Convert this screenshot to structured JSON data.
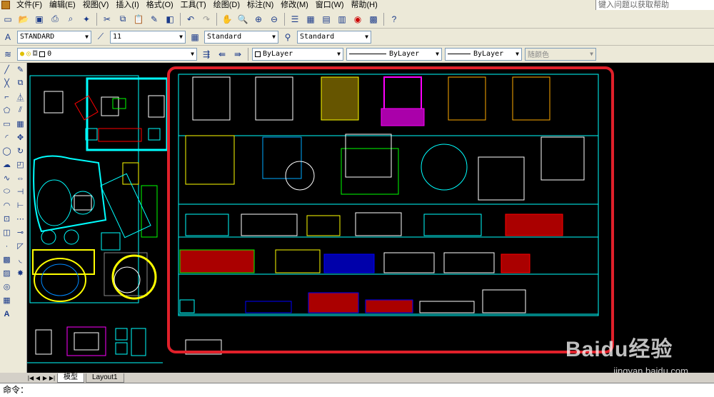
{
  "menu": [
    "文件(F)",
    "编辑(E)",
    "视图(V)",
    "插入(I)",
    "格式(O)",
    "工具(T)",
    "绘图(D)",
    "标注(N)",
    "修改(M)",
    "窗口(W)",
    "帮助(H)"
  ],
  "help_placeholder": "键入问题以获取帮助",
  "styles": {
    "text_style": "STANDARD",
    "dim_scale": "11",
    "dim_style": "Standard",
    "table_style": "Standard"
  },
  "layers": {
    "current": "0",
    "color": "ByLayer",
    "linetype": "ByLayer",
    "lineweight": "ByLayer",
    "plot_style": "随颜色"
  },
  "tabs": [
    "模型",
    "Layout1"
  ],
  "command_prompt": "命令：",
  "watermark": {
    "brand": "Baidu经验",
    "url": "jingyan.baidu.com"
  },
  "colors": {
    "highlight": "#e0202a",
    "cyan": "#00ffff",
    "yellow": "#ffff00",
    "magenta": "#ff00ff",
    "red": "#ff0000"
  }
}
